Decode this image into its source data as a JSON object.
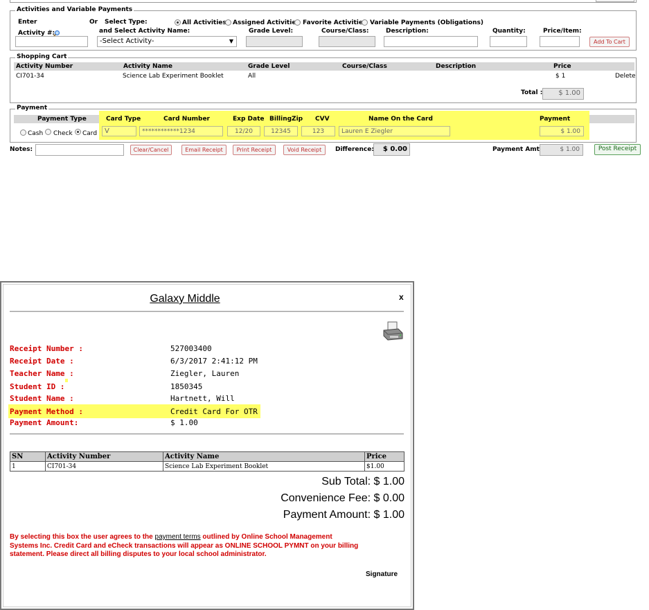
{
  "activities": {
    "legend": "Activities and Variable Payments",
    "enter_label": "Enter",
    "activity_num_label": "Activity #:",
    "or_label": "Or",
    "select_type_label": "Select Type:",
    "types": [
      "All Activities",
      "Assigned Activities",
      "Favorite Activities",
      "Variable Payments (Obligations)"
    ],
    "selected_type": "All Activities",
    "select_name_label": "and Select Activity Name:",
    "select_activity_value": "-Select Activity-",
    "grade_level_label": "Grade Level:",
    "course_class_label": "Course/Class:",
    "description_label": "Description:",
    "quantity_label": "Quantity:",
    "price_item_label": "Price/Item:",
    "add_to_cart_label": "Add To Cart"
  },
  "cart": {
    "legend": "Shopping Cart",
    "headers": [
      "Activity Number",
      "Activity Name",
      "Grade Level",
      "Course/Class",
      "Description",
      "Price"
    ],
    "rows": [
      {
        "number": "CI701-34",
        "name": "Science Lab Experiment Booklet",
        "grade": "All",
        "course": "",
        "description": "",
        "price": "$ 1",
        "action": "Delete"
      }
    ],
    "total_label": "Total :",
    "total_value": "$ 1.00"
  },
  "payment": {
    "legend": "Payment",
    "headers": {
      "type": "Payment Type",
      "card_type": "Card Type",
      "card_number": "Card Number",
      "exp": "Exp Date",
      "zip": "BillingZip",
      "cvv": "CVV",
      "name": "Name On the Card",
      "payment": "Payment"
    },
    "types": [
      "Cash",
      "Check",
      "Card"
    ],
    "selected_type": "Card",
    "card_type": "V",
    "card_number": "************1234",
    "exp": "12/20",
    "zip": "12345",
    "cvv": "123",
    "name": "Lauren E Ziegler",
    "amount": "$ 1.00"
  },
  "footer": {
    "notes_label": "Notes:",
    "buttons": [
      "Clear/Cancel",
      "Email Receipt",
      "Print Receipt",
      "Void Receipt"
    ],
    "difference_label": "Difference:",
    "difference_value": "$ 0.00",
    "payment_amt_label": "Payment Amt:",
    "payment_amt_value": "$ 1.00",
    "post_label": "Post Receipt"
  },
  "receipt": {
    "title": "Galaxy Middle",
    "close": "x",
    "print_icon": "printer-icon",
    "fields": [
      {
        "label": "Receipt Number :",
        "value": "527003400"
      },
      {
        "label": "Receipt Date :",
        "value": "6/3/2017 2:41:12 PM"
      },
      {
        "label": "Teacher Name :",
        "value": "Ziegler, Lauren"
      },
      {
        "label": "Student ID :",
        "value": "1850345"
      },
      {
        "label": "Student Name :",
        "value": "Hartnett, Will"
      },
      {
        "label": "Payment Method :",
        "value": "Credit Card For OTR"
      },
      {
        "label": "Payment Amount:",
        "value": "$ 1.00"
      }
    ],
    "table_headers": [
      "SN",
      "Activity Number",
      "Activity Name",
      "Price"
    ],
    "table_rows": [
      {
        "sn": "1",
        "number": "CI701-34",
        "name": "Science Lab Experiment Booklet",
        "price": "$1.00"
      }
    ],
    "sub_total": "Sub Total: $ 1.00",
    "convenience_fee": "Convenience Fee: $ 0.00",
    "payment_amount": "Payment Amount: $ 1.00",
    "terms_before": "By selecting this box the user agrees to the ",
    "terms_link": "payment terms",
    "terms_after_line1": " outlined by Online School Management",
    "terms_line2": "Systems Inc. Credit Card and eCheck transactions will appear as ONLINE SCHOOL PYMNT on your billing",
    "terms_line3": "statement. Please direct all billing disputes to your local school administrator.",
    "signature": "Signature"
  },
  "colors": {
    "highlight": "#ffff66",
    "red_label": "#d10000",
    "button_red": "#c03030",
    "button_green": "#1a6a1a"
  }
}
